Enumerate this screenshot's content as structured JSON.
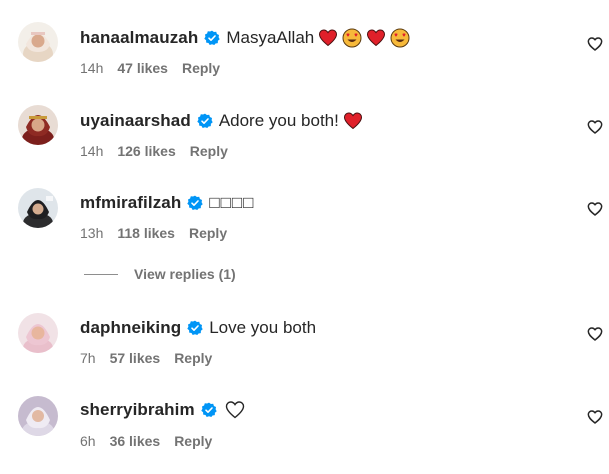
{
  "comments": [
    {
      "username": "hanaalmauzah",
      "text": "MasyaAllah",
      "emojis": [
        "red-heart",
        "heart-eyes",
        "red-heart",
        "heart-eyes"
      ],
      "time": "14h",
      "likes": "47 likes",
      "reply": "Reply"
    },
    {
      "username": "uyainaarshad",
      "text": "Adore you both!",
      "emojis": [
        "red-heart"
      ],
      "time": "14h",
      "likes": "126 likes",
      "reply": "Reply"
    },
    {
      "username": "mfmirafilzah",
      "text": "□□□□",
      "emojis": [],
      "time": "13h",
      "likes": "118 likes",
      "reply": "Reply"
    },
    {
      "username": "daphneiking",
      "text": "Love you both",
      "emojis": [],
      "time": "7h",
      "likes": "57 likes",
      "reply": "Reply"
    },
    {
      "username": "sherryibrahim",
      "text": "",
      "emojis": [
        "outline-heart"
      ],
      "time": "6h",
      "likes": "36 likes",
      "reply": "Reply"
    }
  ],
  "view_replies": "View replies (1)",
  "colors": {
    "verified": "#0095f6",
    "meta_text": "#737373",
    "username_text": "#262626",
    "emoji_heart": "#e0202a",
    "emoji_face": "#f7b93a"
  },
  "icons": {
    "verified": "verified-badge-icon",
    "like": "heart-outline-icon"
  }
}
